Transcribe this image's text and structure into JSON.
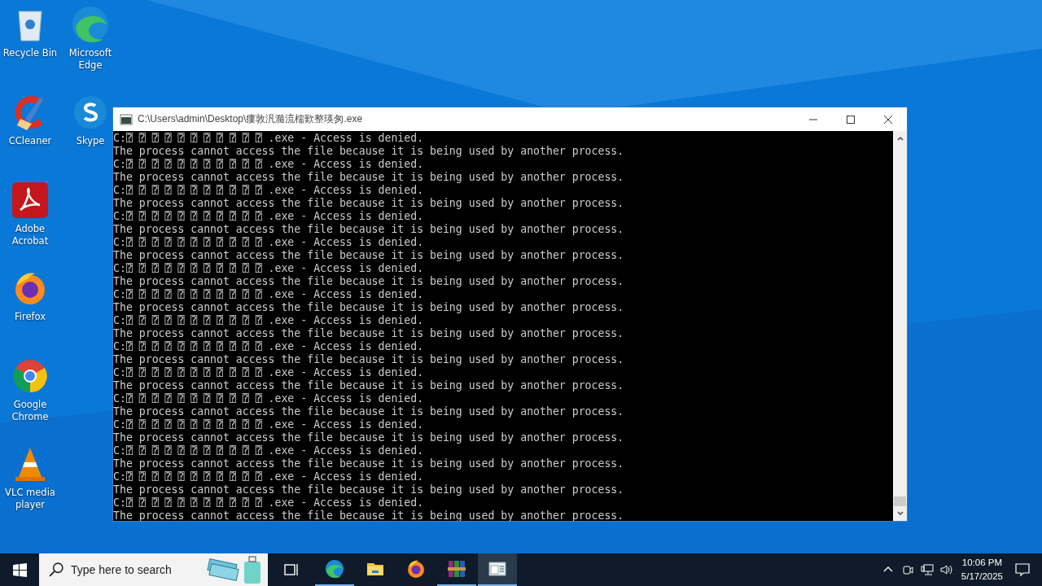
{
  "desktop_icons": [
    {
      "label": "Recycle Bin",
      "kind": "bin"
    },
    {
      "label": "Microsoft Edge",
      "kind": "edge"
    },
    {
      "label": "CCleaner",
      "kind": "ccleaner"
    },
    {
      "label": "Skype",
      "kind": "skype"
    },
    {
      "label": "Adobe Acrobat",
      "kind": "acrobat"
    },
    {
      "label": "Firefox",
      "kind": "firefox"
    },
    {
      "label": "Google Chrome",
      "kind": "chrome"
    },
    {
      "label": "VLC media player",
      "kind": "vlc"
    }
  ],
  "window": {
    "title": "C:\\Users\\admin\\Desktop\\瘻敦汎瀡流檽歎整瑛匆.exe",
    "lines": [
      "C:⍰ ⍰ ⍰ ⍰ ⍰ ⍰ ⍰ ⍰ ⍰ ⍰ ⍰ .exe - Access is denied.",
      "The process cannot access the file because it is being used by another process.",
      "C:⍰ ⍰ ⍰ ⍰ ⍰ ⍰ ⍰ ⍰ ⍰ ⍰ ⍰ .exe - Access is denied.",
      "The process cannot access the file because it is being used by another process.",
      "C:⍰ ⍰ ⍰ ⍰ ⍰ ⍰ ⍰ ⍰ ⍰ ⍰ ⍰ .exe - Access is denied.",
      "The process cannot access the file because it is being used by another process.",
      "C:⍰ ⍰ ⍰ ⍰ ⍰ ⍰ ⍰ ⍰ ⍰ ⍰ ⍰ .exe - Access is denied.",
      "The process cannot access the file because it is being used by another process.",
      "C:⍰ ⍰ ⍰ ⍰ ⍰ ⍰ ⍰ ⍰ ⍰ ⍰ ⍰ .exe - Access is denied.",
      "The process cannot access the file because it is being used by another process.",
      "C:⍰ ⍰ ⍰ ⍰ ⍰ ⍰ ⍰ ⍰ ⍰ ⍰ ⍰ .exe - Access is denied.",
      "The process cannot access the file because it is being used by another process.",
      "C:⍰ ⍰ ⍰ ⍰ ⍰ ⍰ ⍰ ⍰ ⍰ ⍰ ⍰ .exe - Access is denied.",
      "The process cannot access the file because it is being used by another process.",
      "C:⍰ ⍰ ⍰ ⍰ ⍰ ⍰ ⍰ ⍰ ⍰ ⍰ ⍰ .exe - Access is denied.",
      "The process cannot access the file because it is being used by another process.",
      "C:⍰ ⍰ ⍰ ⍰ ⍰ ⍰ ⍰ ⍰ ⍰ ⍰ ⍰ .exe - Access is denied.",
      "The process cannot access the file because it is being used by another process.",
      "C:⍰ ⍰ ⍰ ⍰ ⍰ ⍰ ⍰ ⍰ ⍰ ⍰ ⍰ .exe - Access is denied.",
      "The process cannot access the file because it is being used by another process.",
      "C:⍰ ⍰ ⍰ ⍰ ⍰ ⍰ ⍰ ⍰ ⍰ ⍰ ⍰ .exe - Access is denied.",
      "The process cannot access the file because it is being used by another process.",
      "C:⍰ ⍰ ⍰ ⍰ ⍰ ⍰ ⍰ ⍰ ⍰ ⍰ ⍰ .exe - Access is denied.",
      "The process cannot access the file because it is being used by another process.",
      "C:⍰ ⍰ ⍰ ⍰ ⍰ ⍰ ⍰ ⍰ ⍰ ⍰ ⍰ .exe - Access is denied.",
      "The process cannot access the file because it is being used by another process.",
      "C:⍰ ⍰ ⍰ ⍰ ⍰ ⍰ ⍰ ⍰ ⍰ ⍰ ⍰ .exe - Access is denied.",
      "The process cannot access the file because it is being used by another process.",
      "C:⍰ ⍰ ⍰ ⍰ ⍰ ⍰ ⍰ ⍰ ⍰ ⍰ ⍰ .exe - Access is denied.",
      "The process cannot access the file because it is being used by another process."
    ]
  },
  "taskbar": {
    "search": {
      "placeholder": "Type here to search"
    },
    "apps": [
      {
        "kind": "edge",
        "running": true,
        "selected": false
      },
      {
        "kind": "explorer",
        "running": false,
        "selected": false
      },
      {
        "kind": "firefox",
        "running": false,
        "selected": false
      },
      {
        "kind": "winrar",
        "running": true,
        "selected": false
      },
      {
        "kind": "console",
        "running": true,
        "selected": true
      }
    ],
    "time": "10:06 PM",
    "date": "5/17/2025"
  }
}
